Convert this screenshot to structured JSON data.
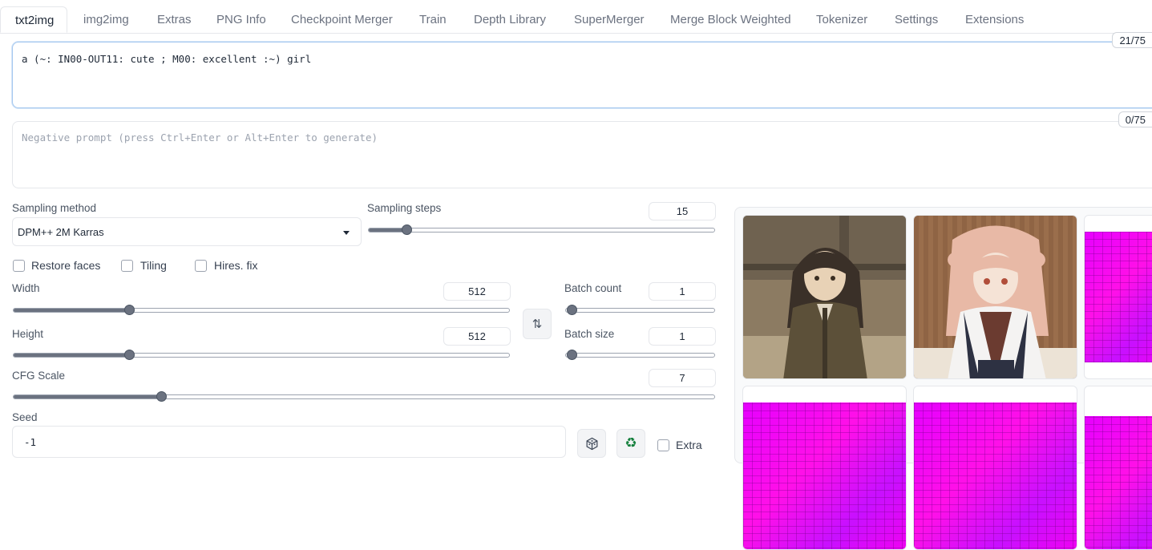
{
  "tabs": [
    "txt2img",
    "img2img",
    "Extras",
    "PNG Info",
    "Checkpoint Merger",
    "Train",
    "Depth Library",
    "SuperMerger",
    "Merge Block Weighted",
    "Tokenizer",
    "Settings",
    "Extensions"
  ],
  "prompt": {
    "value": "a (~: IN00-OUT11: cute ; M00: excellent :~) girl",
    "token_count": "21/75"
  },
  "negative_prompt": {
    "placeholder": "Negative prompt (press Ctrl+Enter or Alt+Enter to generate)",
    "token_count": "0/75"
  },
  "sampling": {
    "method_label": "Sampling method",
    "method_value": "DPM++ 2M Karras",
    "steps_label": "Sampling steps",
    "steps_value": "15",
    "steps_fraction": 0.11
  },
  "options": {
    "restore_faces": "Restore faces",
    "tiling": "Tiling",
    "hires_fix": "Hires. fix"
  },
  "size": {
    "width_label": "Width",
    "width_value": "512",
    "width_fraction": 0.233,
    "height_label": "Height",
    "height_value": "512",
    "height_fraction": 0.233
  },
  "batch": {
    "count_label": "Batch count",
    "count_value": "1",
    "size_label": "Batch size",
    "size_value": "1"
  },
  "cfg": {
    "label": "CFG Scale",
    "value": "7",
    "fraction": 0.21
  },
  "seed": {
    "label": "Seed",
    "value": "-1",
    "extra_label": "Extra"
  },
  "icons": {
    "swap": "swap-dimensions-icon",
    "dice": "dice-icon",
    "recycle": "recycle-icon"
  },
  "colors": {
    "accent_border": "#a5c8ef",
    "slider": "#6b7280",
    "noise_magenta": "#e600ff"
  }
}
